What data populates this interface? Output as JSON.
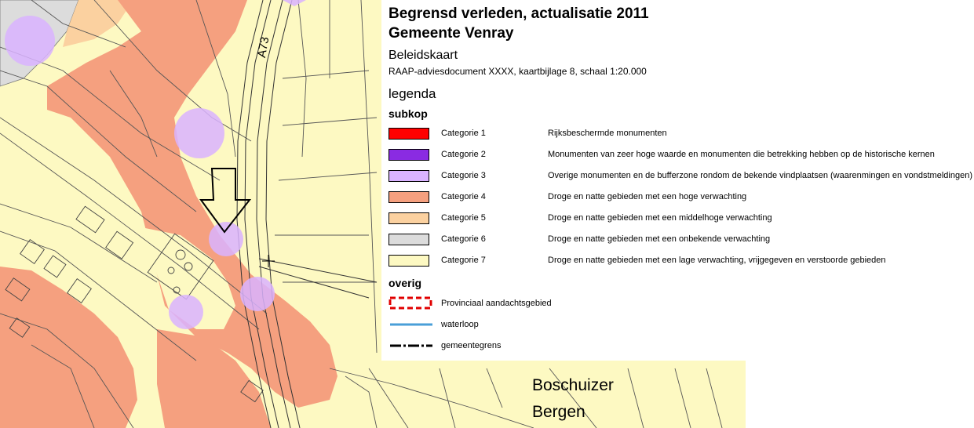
{
  "legend": {
    "title_line1": "Begrensd verleden, actualisatie 2011",
    "title_line2": "Gemeente Venray",
    "subtitle": "Beleidskaart",
    "document_info": "RAAP-adviesdocument XXXX, kaartbijlage 8, schaal 1:20.000",
    "legenda_label": "legenda",
    "subkop_label": "subkop",
    "categories": [
      {
        "name": "Categorie 1",
        "description": "Rijksbeschermde monumenten",
        "color": "#ff0000"
      },
      {
        "name": "Categorie 2",
        "description": "Monumenten van zeer hoge waarde en monumenten die betrekking hebben op de historische kernen",
        "color": "#8a2be2"
      },
      {
        "name": "Categorie 3",
        "description": "Overige monumenten en de bufferzone rondom de bekende vindplaatsen (waarenmingen en vondstmeldingen)",
        "color": "#d9b3ff"
      },
      {
        "name": "Categorie 4",
        "description": "Droge en natte gebieden met een hoge verwachting",
        "color": "#f5a07f"
      },
      {
        "name": "Categorie 5",
        "description": "Droge en natte gebieden met een middelhoge verwachting",
        "color": "#fbd1a0"
      },
      {
        "name": "Categorie 6",
        "description": "Droge en natte gebieden met een onbekende verwachting",
        "color": "#dcdcdc"
      },
      {
        "name": "Categorie 7",
        "description": "Droge en natte gebieden met een lage verwachting, vrijgegeven en verstoorde gebieden",
        "color": "#fdf9c2"
      }
    ],
    "overig_label": "overig",
    "other_items": [
      {
        "name": "Provinciaal aandachtsgebied",
        "symbol": "dashed-red-box",
        "color": "#e00000"
      },
      {
        "name": "waterloop",
        "symbol": "line",
        "color": "#4a9fd8"
      },
      {
        "name": "gemeentegrens",
        "symbol": "dash-dot-line",
        "color": "#000000"
      }
    ]
  },
  "map": {
    "road_label": "A73",
    "place_label_line1": "Boschuizer",
    "place_label_line2": "Bergen",
    "colors": {
      "background": "#fdf9c2",
      "high": "#f5a07f",
      "medium": "#fbd1a0",
      "unknown": "#dcdcdc",
      "buffer": "#d9b3ff",
      "lines": "#555555"
    },
    "arrow_icon": "down-arrow-icon"
  }
}
